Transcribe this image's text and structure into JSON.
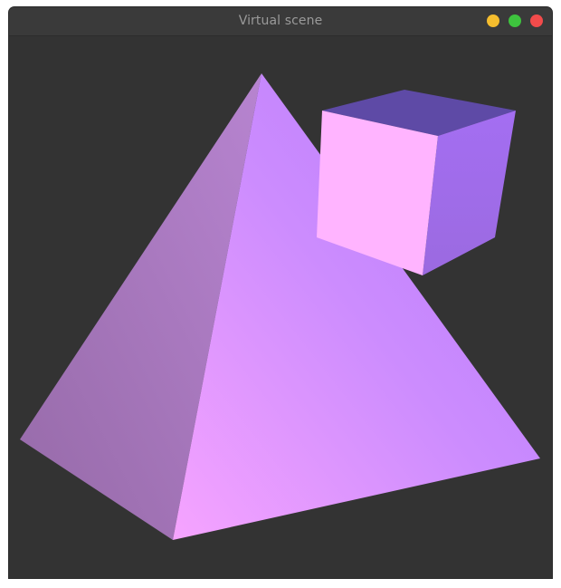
{
  "window": {
    "title": "Virtual scene",
    "background": "#333333",
    "titlebar_background": "#3a3a3a"
  },
  "controls": {
    "minimize_color": "#f5bd2e",
    "maximize_color": "#3ec43e",
    "close_color": "#f24b4b"
  },
  "scene": {
    "objects": [
      "pyramid",
      "cube"
    ],
    "pyramid_colors": {
      "left_face_light": "#b784d0",
      "left_face_dark": "#966aa8",
      "front_face_light": "#f6a4ff",
      "front_face_mid": "#cc8cfe",
      "front_face_dark": "#b478fa"
    },
    "cube_colors": {
      "front_face": "#ffb4ff",
      "top_face": "#5e4aa6",
      "right_face_light": "#a46ef2",
      "right_face_dark": "#9b6ae0"
    }
  }
}
